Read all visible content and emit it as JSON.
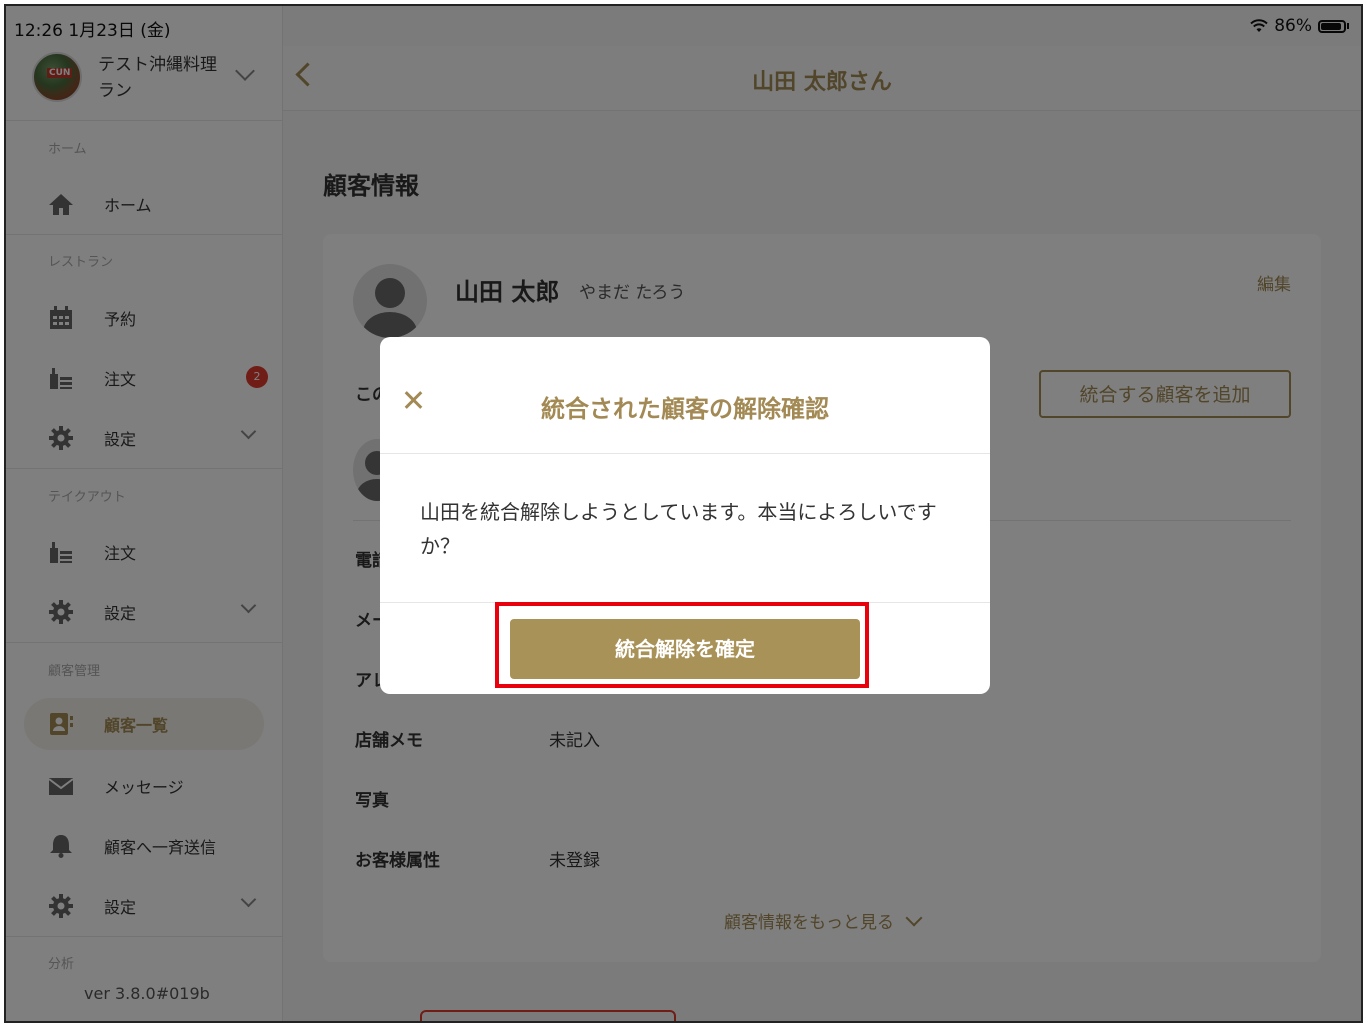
{
  "status": {
    "time": "12:26  1月23日 (金)",
    "battery": "86%"
  },
  "store": {
    "name": "テスト沖縄料理ラン",
    "logo_text": "CUN"
  },
  "sidebar": {
    "sections": {
      "home": "ホーム",
      "restaurant": "レストラン",
      "takeout": "テイクアウト",
      "customers": "顧客管理",
      "analytics": "分析"
    },
    "items": {
      "home": "ホーム",
      "reservation": "予約",
      "orders": "注文",
      "orders_badge": "2",
      "settings": "設定",
      "takeout_orders": "注文",
      "takeout_settings": "設定",
      "customer_list": "顧客一覧",
      "messages": "メッセージ",
      "broadcast": "顧客へ一斉送信",
      "customer_settings": "設定"
    },
    "version": "ver 3.8.0#019b"
  },
  "header": {
    "title": "山田 太郎さん"
  },
  "main": {
    "section_title": "顧客情報",
    "customer": {
      "name": "山田 太郎",
      "kana": "やまだ たろう"
    },
    "edit": "編集",
    "add_merge": "統合する顧客を追加",
    "truncated": {
      "merge_text": "この",
      "phone": "電話",
      "mail": "メー",
      "allergy": "アレ"
    },
    "info": [
      {
        "label": "店舗メモ",
        "value": "未記入"
      },
      {
        "label": "写真",
        "value": ""
      },
      {
        "label": "お客様属性",
        "value": "未登録"
      }
    ],
    "more": "顧客情報をもっと見る"
  },
  "modal": {
    "title": "統合された顧客の解除確認",
    "message": "山田を統合解除しようとしています。本当によろしいですか？",
    "confirm": "統合解除を確定"
  },
  "colors": {
    "accent": "#a38a55",
    "badge": "#e03a2e",
    "highlight": "#e8000d"
  }
}
